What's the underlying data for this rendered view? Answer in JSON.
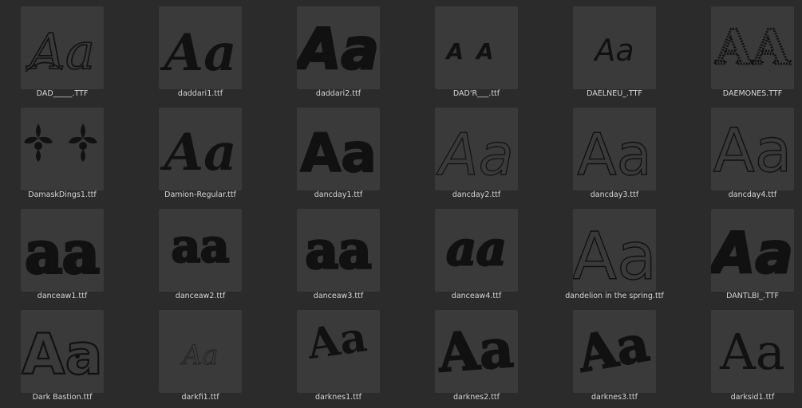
{
  "fonts": [
    {
      "file": "DAD_____.TTF",
      "icon": "script-aa-preview-icon"
    },
    {
      "file": "daddari1.ttf",
      "icon": "brush-aa-preview-icon"
    },
    {
      "file": "daddari2.ttf",
      "icon": "bold-brush-aa-preview-icon"
    },
    {
      "file": "DAD'R___.ttf",
      "icon": "small-caps-aa-preview-icon"
    },
    {
      "file": "DAELNEU_.TTF",
      "icon": "hand-aa-preview-icon"
    },
    {
      "file": "DAEMONES.TTF",
      "icon": "distressed-aa-preview-icon"
    },
    {
      "file": "DamaskDings1.ttf",
      "icon": "damask-ornament-preview-icon"
    },
    {
      "file": "Damion-Regular.ttf",
      "icon": "script-bold-aa-preview-icon"
    },
    {
      "file": "dancday1.ttf",
      "icon": "heavy-sans-aa-preview-icon"
    },
    {
      "file": "dancday2.ttf",
      "icon": "thin-sans-aa-preview-icon"
    },
    {
      "file": "dancday3.ttf",
      "icon": "thin-sans-aa-preview-icon"
    },
    {
      "file": "dancday4.ttf",
      "icon": "thin-sans-aa-preview-icon"
    },
    {
      "file": "danceaw1.ttf",
      "icon": "blob-aa-preview-icon"
    },
    {
      "file": "danceaw2.ttf",
      "icon": "blob-aa-preview-icon"
    },
    {
      "file": "danceaw3.ttf",
      "icon": "blob-aa-preview-icon"
    },
    {
      "file": "danceaw4.ttf",
      "icon": "blob-aa-preview-icon"
    },
    {
      "file": "dandelion in the spring.ttf",
      "icon": "thin-hand-aa-preview-icon"
    },
    {
      "file": "DANTLBI_.TTF",
      "icon": "heavy-slant-aa-preview-icon"
    },
    {
      "file": "Dark Bastion.ttf",
      "icon": "outlined-aa-preview-icon"
    },
    {
      "file": "darkfi1.ttf",
      "icon": "faint-script-aa-preview-icon"
    },
    {
      "file": "darknes1.ttf",
      "icon": "angular-aa-preview-icon"
    },
    {
      "file": "darknes2.ttf",
      "icon": "angular-aa-preview-icon"
    },
    {
      "file": "darknes3.ttf",
      "icon": "angular-aa-preview-icon"
    },
    {
      "file": "darksid1.ttf",
      "icon": "serif-aa-preview-icon"
    }
  ],
  "preview_text": "Aa"
}
